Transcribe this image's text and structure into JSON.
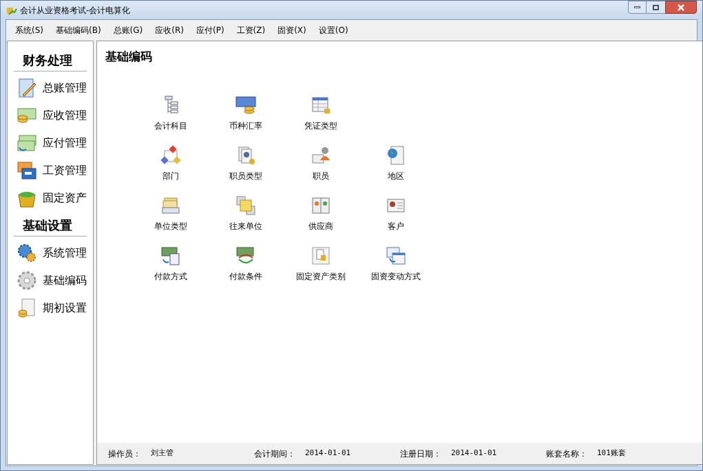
{
  "window": {
    "title": "会计从业资格考试-会计电算化"
  },
  "menu": [
    "系统(S)",
    "基础编码(B)",
    "总账(G)",
    "应收(R)",
    "应付(P)",
    "工资(Z)",
    "固资(X)",
    "设置(O)"
  ],
  "sidebar": {
    "sections": [
      {
        "title": "财务处理",
        "items": [
          "总账管理",
          "应收管理",
          "应付管理",
          "工资管理",
          "固定资产"
        ]
      },
      {
        "title": "基础设置",
        "items": [
          "系统管理",
          "基础编码",
          "期初设置"
        ]
      }
    ]
  },
  "main": {
    "heading": "基础编码",
    "rows": [
      [
        "会计科目",
        "币种汇率",
        "凭证类型"
      ],
      [
        "部门",
        "职员类型",
        "职员",
        "地区"
      ],
      [
        "单位类型",
        "往来单位",
        "供应商",
        "客户"
      ],
      [
        "付款方式",
        "付款条件",
        "固定资产类别",
        "固资变动方式"
      ]
    ]
  },
  "status_bar": [
    {
      "label": "操作员：",
      "value": "刘主管"
    },
    {
      "label": "会计期间：",
      "value": "2014-01-01"
    },
    {
      "label": "注册日期：",
      "value": "2014-01-01"
    },
    {
      "label": "账套名称：",
      "value": "101账套"
    }
  ]
}
